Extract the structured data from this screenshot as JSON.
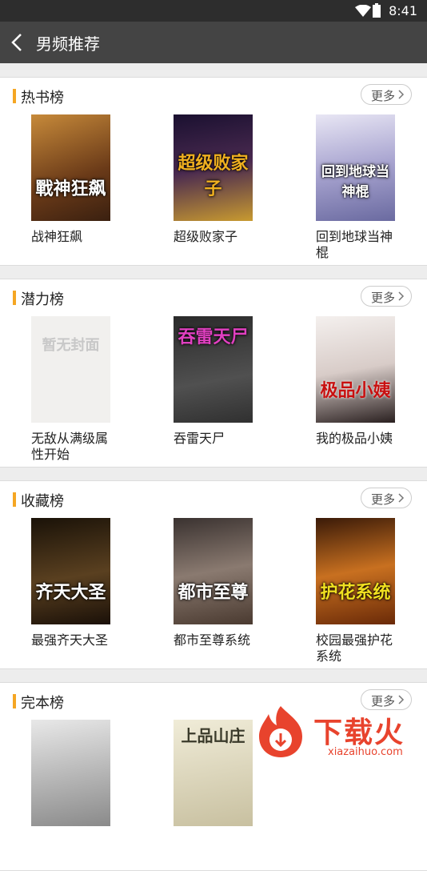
{
  "status_bar": {
    "time": "8:41"
  },
  "header": {
    "title": "男频推荐"
  },
  "more_label": "更多",
  "sections": [
    {
      "title": "热书榜",
      "books": [
        {
          "title": "战神狂飙",
          "cover_text": "戰神狂飙",
          "color": "#8a4a1a"
        },
        {
          "title": "超级败家子",
          "cover_text": "超级败家子",
          "color": "#2a1a3a"
        },
        {
          "title": "回到地球当神棍",
          "cover_text": "回到地球当神棍",
          "color": "#b9b6d8"
        }
      ]
    },
    {
      "title": "潜力榜",
      "books": [
        {
          "title": "无敌从满级属性开始",
          "cover_text": "暂无封面",
          "color": "#f1f0ee"
        },
        {
          "title": "吞雷天尸",
          "cover_text": "吞雷天尸",
          "color": "#3a3a3a"
        },
        {
          "title": "我的极品小姨",
          "cover_text": "极品小姨",
          "color": "#e8e2e0"
        }
      ]
    },
    {
      "title": "收藏榜",
      "books": [
        {
          "title": "最强齐天大圣",
          "cover_text": "齐天大圣",
          "color": "#2a1e12"
        },
        {
          "title": "都市至尊系统",
          "cover_text": "都市至尊",
          "color": "#5a4a40"
        },
        {
          "title": "校园最强护花系统",
          "cover_text": "护花系统",
          "color": "#7a3a10"
        }
      ]
    },
    {
      "title": "完本榜",
      "books": [
        {
          "title": "",
          "cover_text": "",
          "color": "#8a8a8a"
        },
        {
          "title": "",
          "cover_text": "上品山庄",
          "color": "#d8d0b8"
        },
        {
          "title": "",
          "cover_text": "",
          "color": "#cccccc"
        }
      ]
    }
  ],
  "watermark": {
    "name": "下载火",
    "url": "xiazaihuo.com"
  }
}
